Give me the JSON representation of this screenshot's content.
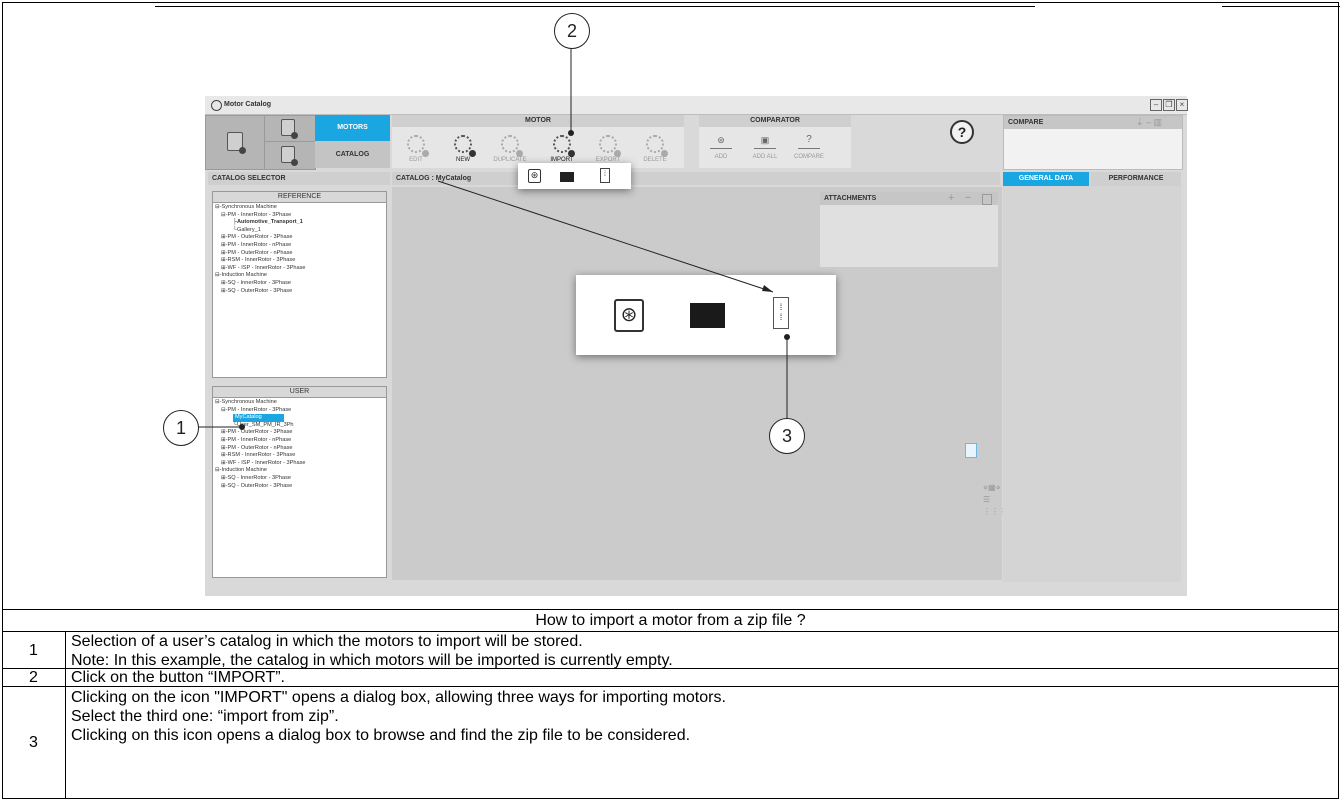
{
  "app": {
    "window_title": "Motor Catalog",
    "nav": {
      "motors": "MOTORS",
      "catalog": "CATALOG"
    },
    "motor_group": {
      "title": "MOTOR",
      "buttons": [
        {
          "label": "EDIT",
          "enabled": false
        },
        {
          "label": "NEW",
          "enabled": true
        },
        {
          "label": "DUPLICATE",
          "enabled": false
        },
        {
          "label": "IMPORT",
          "enabled": true
        },
        {
          "label": "EXPORT",
          "enabled": false
        },
        {
          "label": "DELETE",
          "enabled": false
        }
      ]
    },
    "comparator_group": {
      "title": "COMPARATOR",
      "buttons": [
        {
          "label": "ADD"
        },
        {
          "label": "ADD ALL"
        },
        {
          "label": "COMPARE"
        }
      ]
    },
    "help": "?",
    "compare_panel": {
      "title": "COMPARE"
    },
    "catalog_selector": {
      "title": "CATALOG SELECTOR",
      "reference": {
        "title": "REFERENCE",
        "items": [
          "⊟-Synchronous Machine",
          "  ⊟-PM - InnerRotor - 3Phase",
          "      ├Automotive_Transport_1",
          "      └Gallery_1",
          "  ⊞-PM - OuterRotor - 3Phase",
          "  ⊞-PM - InnerRotor - nPhase",
          "  ⊞-PM - OuterRotor - nPhase",
          "  ⊞-RSM - InnerRotor - 3Phase",
          "  ⊞-WF - ISP - InnerRotor - 3Phase",
          "⊟-Induction Machine",
          "  ⊞-SQ - InnerRotor - 3Phase",
          "  ⊞-SQ - OuterRotor - 3Phase"
        ]
      },
      "user": {
        "title": "USER",
        "items": [
          "⊟-Synchronous Machine",
          "  ⊟-PM - InnerRotor - 3Phase",
          "      MyCatalog",
          "      └User_SM_PM_IR_3Ph",
          "  ⊞-PM - OuterRotor - 3Phase",
          "  ⊞-PM - InnerRotor - nPhase",
          "  ⊞-PM - OuterRotor - nPhase",
          "  ⊞-RSM - InnerRotor - 3Phase",
          "  ⊞-WF - ISP - InnerRotor - 3Phase",
          "⊟-Induction Machine",
          "  ⊞-SQ - InnerRotor - 3Phase",
          "  ⊞-SQ - OuterRotor - 3Phase"
        ]
      }
    },
    "catalog_header": "CATALOG : MyCatalog",
    "attachments": {
      "title": "ATTACHMENTS",
      "add": "+",
      "remove": "−"
    },
    "right_tabs": {
      "general": "GENERAL DATA",
      "performance": "PERFORMANCE"
    }
  },
  "callouts": [
    "1",
    "2",
    "3"
  ],
  "table": {
    "heading": "How to import a motor from a zip file ?",
    "rows": [
      {
        "num": "1",
        "lines": [
          "Selection of a user’s catalog in which the motors to import will be stored.",
          "Note: In this example, the catalog in which motors will be imported is currently empty."
        ]
      },
      {
        "num": "2",
        "lines": [
          "Click on the button “IMPORT”."
        ]
      },
      {
        "num": "3",
        "lines": [
          "Clicking on the icon \"IMPORT\" opens a dialog box, allowing three ways for importing motors.",
          "Select the third one: “import from zip”.",
          "Clicking on this icon opens a dialog box to browse and find the zip file to be considered."
        ]
      }
    ]
  },
  "colors": {
    "accent": "#1aa7e1",
    "panel": "#cbcbcb"
  }
}
